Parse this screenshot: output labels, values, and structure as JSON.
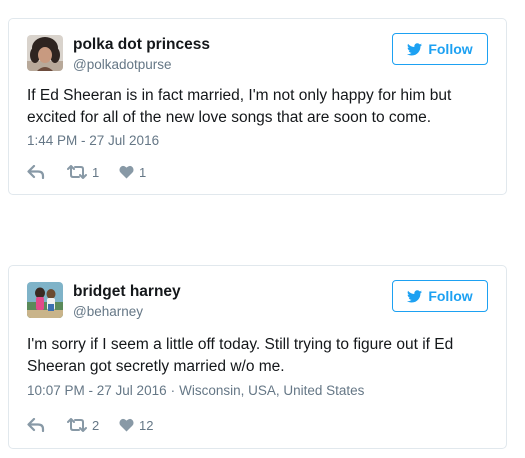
{
  "tweets": [
    {
      "name": "polka dot princess",
      "handle": "@polkadotpurse",
      "follow_label": "Follow",
      "text": "If Ed Sheeran is in fact married, I'm not only happy for him but excited for all of the new love songs that are soon to come.",
      "timestamp": "1:44 PM - 27 Jul 2016",
      "location": "",
      "retweets": "1",
      "likes": "1"
    },
    {
      "name": "bridget harney",
      "handle": "@beharney",
      "follow_label": "Follow",
      "text": "I'm sorry if I seem a little off today. Still trying to figure out if Ed Sheeran got secretly married w/o me.",
      "timestamp": "10:07 PM - 27 Jul 2016",
      "location": "Wisconsin, USA, United States",
      "retweets": "2",
      "likes": "12"
    }
  ],
  "icons": {
    "follow": "twitter-bird-icon",
    "reply": "reply-icon",
    "retweet": "retweet-icon",
    "like": "heart-icon"
  },
  "colors": {
    "accent": "#1da1f2",
    "muted": "#657786",
    "action": "#8899a6",
    "border": "#e1e8ed",
    "text": "#14171a"
  }
}
